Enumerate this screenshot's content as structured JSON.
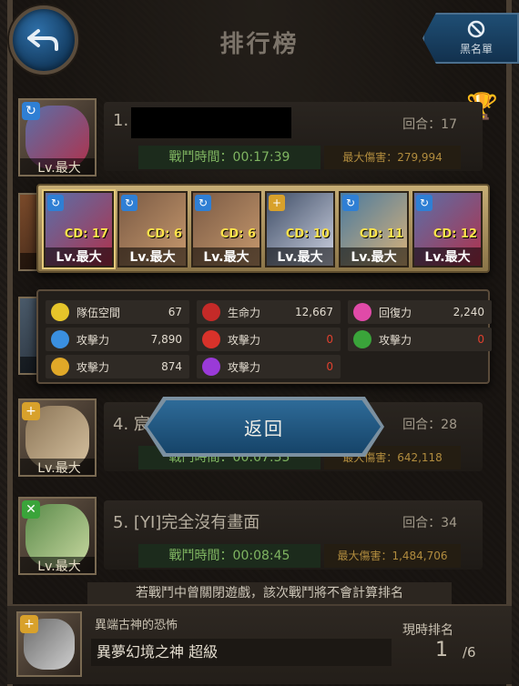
{
  "header": {
    "title": "排行榜",
    "blacklist_label": "黑名單"
  },
  "rankings": [
    {
      "rank": "1.",
      "name": "",
      "round": "回合：17",
      "battle_time": "戰鬥時間：00:17:39",
      "max_damage": "最大傷害：279,994",
      "lv": "Lv.最大"
    },
    {
      "rank": "4.",
      "name": "宸",
      "round": "回合：28",
      "battle_time": "戰鬥時間：00:07:55",
      "max_damage": "最大傷害：642,118",
      "lv": "Lv.最大"
    },
    {
      "rank": "5.",
      "name": "[YI]完全沒有畫面",
      "round": "回合：34",
      "battle_time": "戰鬥時間：00:08:45",
      "max_damage": "最大傷害：1,484,706",
      "lv": "Lv.最大"
    }
  ],
  "hidden_row_labels": [
    "Lv.最大",
    "Lv.最大"
  ],
  "team": [
    {
      "cd": "CD: 17",
      "lv": "Lv.最大",
      "badge_color": "#2f7fd4",
      "palette": [
        "#5a6fa8",
        "#b0324c"
      ]
    },
    {
      "cd": "CD: 6",
      "lv": "Lv.最大",
      "badge_color": "#2f7fd4",
      "palette": [
        "#7a5a44",
        "#c89a6e"
      ]
    },
    {
      "cd": "CD: 6",
      "lv": "Lv.最大",
      "badge_color": "#2f7fd4",
      "palette": [
        "#7a5a44",
        "#c89a6e"
      ]
    },
    {
      "cd": "CD: 10",
      "lv": "Lv.最大",
      "badge_color": "#d8a12b",
      "palette": [
        "#3e4d66",
        "#cfd3e2"
      ]
    },
    {
      "cd": "CD: 11",
      "lv": "Lv.最大",
      "badge_color": "#2f7fd4",
      "palette": [
        "#4a7a9e",
        "#d9b27a"
      ]
    },
    {
      "cd": "CD: 12",
      "lv": "Lv.最大",
      "badge_color": "#2f7fd4",
      "palette": [
        "#5a6fa8",
        "#b0324c"
      ]
    }
  ],
  "stats": [
    {
      "icon": "flag-icon",
      "color": "#e6c52a",
      "label": "隊伍空間",
      "value": "67",
      "red": false
    },
    {
      "icon": "life-drop-icon",
      "color": "#c42a28",
      "label": "生命力",
      "value": "12,667",
      "red": false
    },
    {
      "icon": "heart-icon",
      "color": "#e04aa8",
      "label": "回復力",
      "value": "2,240",
      "red": false
    },
    {
      "icon": "water-rune-icon",
      "color": "#3a8fe0",
      "label": "攻擊力",
      "value": "7,890",
      "red": false
    },
    {
      "icon": "fire-rune-icon",
      "color": "#d8322a",
      "label": "攻擊力",
      "value": "0",
      "red": true
    },
    {
      "icon": "wood-rune-icon",
      "color": "#3aa43a",
      "label": "攻擊力",
      "value": "0",
      "red": true
    },
    {
      "icon": "light-rune-icon",
      "color": "#e0a828",
      "label": "攻擊力",
      "value": "874",
      "red": false
    },
    {
      "icon": "dark-rune-icon",
      "color": "#9a3ad8",
      "label": "攻擊力",
      "value": "0",
      "red": true
    }
  ],
  "return_label": "返回",
  "footer": {
    "notice": "若戰鬥中曾關閉遊戲，該次戰鬥將不會計算排名",
    "subtitle": "異端古神的恐怖",
    "stage": "異夢幻境之神 超級",
    "current_rank_label": "現時排名",
    "current_rank": "1",
    "total": "/6"
  }
}
